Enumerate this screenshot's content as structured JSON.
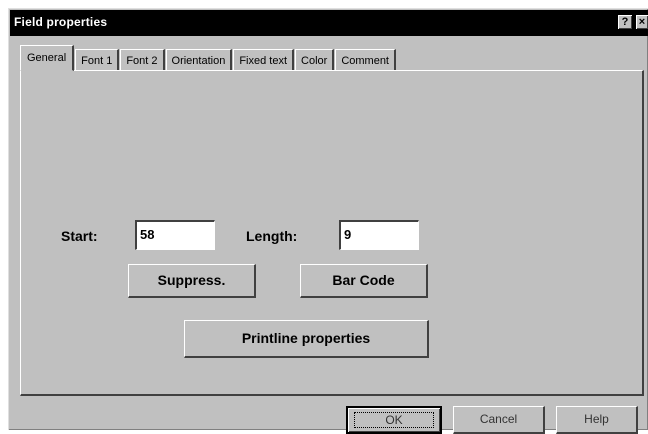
{
  "window": {
    "title": "Field properties",
    "help_glyph": "?",
    "close_glyph": "×"
  },
  "tabs": [
    {
      "label": "General"
    },
    {
      "label": "Font 1"
    },
    {
      "label": "Font 2"
    },
    {
      "label": "Orientation"
    },
    {
      "label": "Fixed text"
    },
    {
      "label": "Color"
    },
    {
      "label": "Comment"
    }
  ],
  "general": {
    "start_label": "Start:",
    "start_value": "58",
    "length_label": "Length:",
    "length_value": "9",
    "suppress_label": "Suppress.",
    "barcode_label": "Bar Code",
    "printline_label": "Printline properties"
  },
  "footer": {
    "ok_label": "OK",
    "cancel_label": "Cancel",
    "help_label": "Help"
  }
}
